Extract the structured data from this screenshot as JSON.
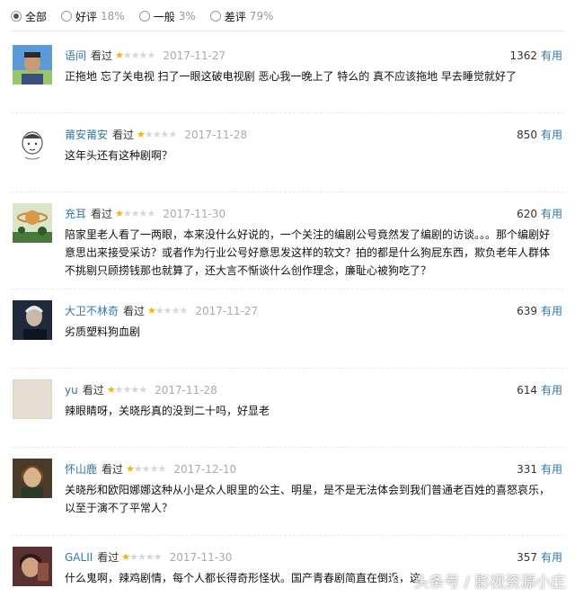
{
  "filters": [
    {
      "label": "全部",
      "pct": "",
      "selected": true
    },
    {
      "label": "好评",
      "pct": "18%",
      "selected": false
    },
    {
      "label": "一般",
      "pct": "3%",
      "selected": false
    },
    {
      "label": "差评",
      "pct": "79%",
      "selected": false
    }
  ],
  "seen_label": "看过",
  "useful_label": "有用",
  "rating_stars": 1,
  "colors": {
    "link": "#3377aa",
    "star": "#f4b400",
    "date": "#aaaaaa"
  },
  "comments": [
    {
      "user": "语间",
      "date": "2017-11-27",
      "votes": "1362",
      "text": "正拖地 忘了关电视 扫了一眼这破电视剧 恶心我一晚上了 特么的 真不应该拖地 早去睡觉就好了",
      "avatar": "person-photo"
    },
    {
      "user": "莆安莆安",
      "date": "2017-11-28",
      "votes": "850",
      "text": "这年头还有这种剧啊？",
      "avatar": "cartoon-face"
    },
    {
      "user": "充耳",
      "date": "2017-11-30",
      "votes": "620",
      "text": "陪家里老人看了一两眼，本来没什么好说的，一个关注的编剧公号竟然发了编剧的访谈。。。那个编剧好意思出来接受采访？或者作为行业公号好意思发这样的软文？拍的都是什么狗屁东西，欺负老年人群体不挑剔只顾捞钱那也就算了，还大言不惭谈什么创作理念，廉耻心被狗吃了？",
      "avatar": "planet-scene"
    },
    {
      "user": "大卫不林奇",
      "date": "2017-11-27",
      "votes": "639",
      "text": "劣质塑料狗血剧",
      "avatar": "person-photo"
    },
    {
      "user": "yu",
      "date": "2017-11-28",
      "votes": "614",
      "text": "辣眼睛呀，关晓彤真的没到二十吗，好显老",
      "avatar": "plain-beige"
    },
    {
      "user": "怀山鹿",
      "date": "2017-12-10",
      "votes": "331",
      "text": "关晓彤和欧阳娜娜这种从小是众人眼里的公主、明星，是不是无法体会到我们普通老百姓的喜怒哀乐，以至于演不了平常人？",
      "avatar": "painting-portrait"
    },
    {
      "user": "GALII",
      "date": "2017-11-30",
      "votes": "357",
      "text": "什么鬼啊，辣鸡剧情，每个人都长得奇形怪状。国产青春剧简直在倒退，这",
      "avatar": "person-photo"
    }
  ],
  "watermark": "头条号 / 影视资源小庄"
}
